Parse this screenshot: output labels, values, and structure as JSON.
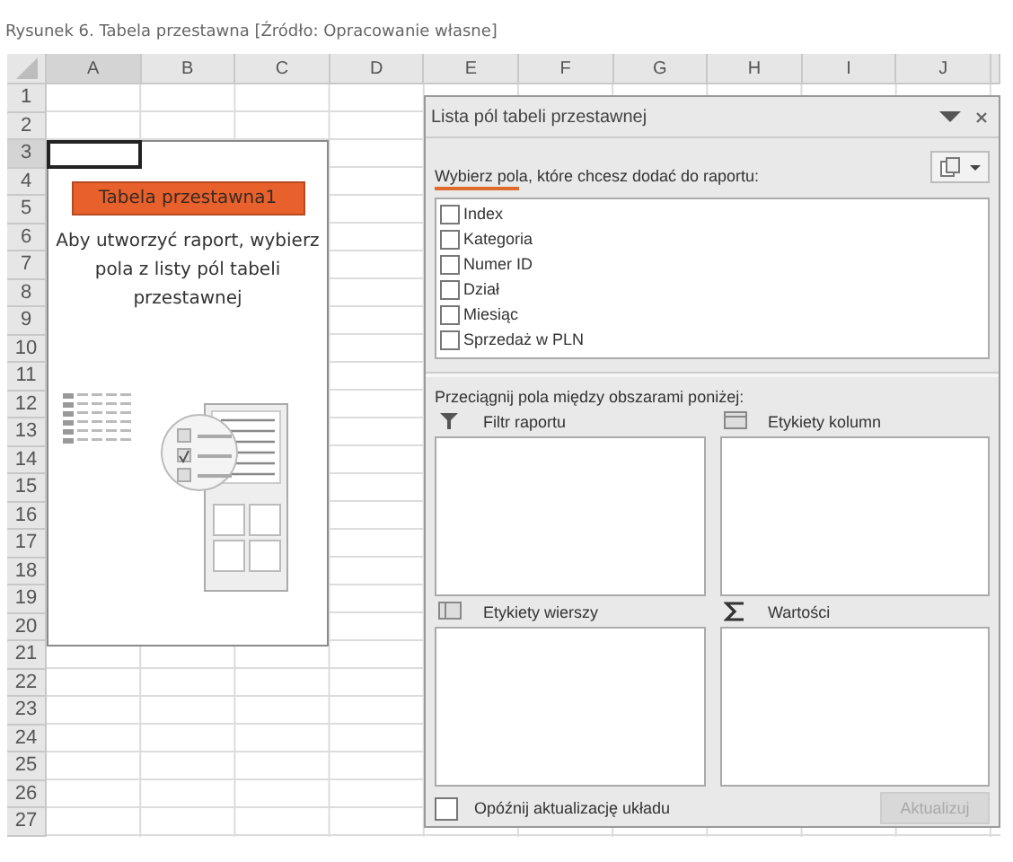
{
  "caption": "Rysunek 6. Tabela przestawna [Źródło: Opracowanie własne]",
  "sheet": {
    "columns": [
      {
        "label": "A",
        "active": true
      },
      {
        "label": "B",
        "active": false
      },
      {
        "label": "C",
        "active": false
      },
      {
        "label": "D",
        "active": false
      },
      {
        "label": "E",
        "active": false
      },
      {
        "label": "F",
        "active": false
      },
      {
        "label": "G",
        "active": false
      },
      {
        "label": "H",
        "active": false
      },
      {
        "label": "I",
        "active": false
      },
      {
        "label": "J",
        "active": false
      }
    ],
    "rows": [
      {
        "label": "1",
        "active": false
      },
      {
        "label": "2",
        "active": false
      },
      {
        "label": "3",
        "active": true
      },
      {
        "label": "4",
        "active": false
      },
      {
        "label": "5",
        "active": false
      },
      {
        "label": "6",
        "active": false
      },
      {
        "label": "7",
        "active": false
      },
      {
        "label": "8",
        "active": false
      },
      {
        "label": "9",
        "active": false
      },
      {
        "label": "10",
        "active": false
      },
      {
        "label": "11",
        "active": false
      },
      {
        "label": "12",
        "active": false
      },
      {
        "label": "13",
        "active": false
      },
      {
        "label": "14",
        "active": false
      },
      {
        "label": "15",
        "active": false
      },
      {
        "label": "16",
        "active": false
      },
      {
        "label": "17",
        "active": false
      },
      {
        "label": "18",
        "active": false
      },
      {
        "label": "19",
        "active": false
      },
      {
        "label": "20",
        "active": false
      },
      {
        "label": "21",
        "active": false
      },
      {
        "label": "22",
        "active": false
      },
      {
        "label": "23",
        "active": false
      },
      {
        "label": "24",
        "active": false
      },
      {
        "label": "25",
        "active": false
      },
      {
        "label": "26",
        "active": false
      },
      {
        "label": "27",
        "active": false
      }
    ]
  },
  "placeholder": {
    "title": "Tabela przestawna1",
    "text": "Aby utworzyć raport, wybierz pola z listy pól tabeli przestawnej"
  },
  "field_list": {
    "title": "Lista pól tabeli przestawnej",
    "instruction": "Wybierz pola, które chcesz dodać do raportu:",
    "fields": [
      {
        "label": "Index",
        "checked": false
      },
      {
        "label": "Kategoria",
        "checked": false
      },
      {
        "label": "Numer ID",
        "checked": false
      },
      {
        "label": "Dział",
        "checked": false
      },
      {
        "label": "Miesiąc",
        "checked": false
      },
      {
        "label": "Sprzedaż w PLN",
        "checked": false
      }
    ],
    "drag_hint": "Przeciągnij pola między obszarami poniżej:",
    "areas": [
      {
        "kind": "filter",
        "label": "Filtr raportu"
      },
      {
        "kind": "columns",
        "label": "Etykiety kolumn"
      },
      {
        "kind": "rows",
        "label": "Etykiety wierszy"
      },
      {
        "kind": "values",
        "label": "Wartości"
      }
    ],
    "defer": {
      "label": "Opóźnij aktualizację układu",
      "checked": false
    },
    "update_button": {
      "label": "Aktualizuj",
      "disabled": true
    }
  }
}
